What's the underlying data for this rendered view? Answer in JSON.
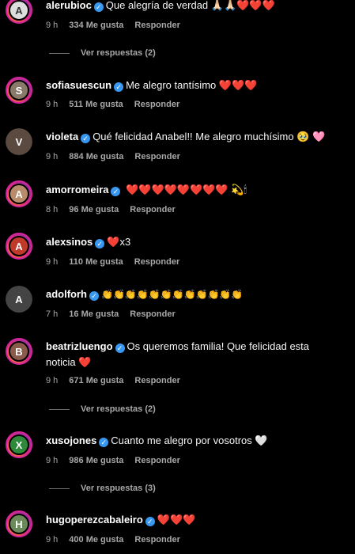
{
  "comments": [
    {
      "user": "alerubioc",
      "text": "Que alegría de verdad",
      "emoji": "🙏🏻🙏🏻❤️❤️❤️",
      "time": "9 h",
      "likes": "334 Me gusta",
      "reply": "Responder",
      "replies": "Ver respuestas (2)"
    },
    {
      "user": "sofiasuescun",
      "text": "Me alegro tantísimo",
      "emoji": "❤️❤️❤️",
      "time": "9 h",
      "likes": "511 Me gusta",
      "reply": "Responder"
    },
    {
      "user": "violeta",
      "text": "Qué felicidad Anabel!! Me alegro muchísimo",
      "emoji": "🥹 🩷",
      "time": "9 h",
      "likes": "884 Me gusta",
      "reply": "Responder"
    },
    {
      "user": "amorromeira",
      "text": "",
      "emoji": "❤️❤️❤️❤️❤️❤️❤️❤️ 💫🕯",
      "time": "8 h",
      "likes": "96 Me gusta",
      "reply": "Responder"
    },
    {
      "user": "alexsinos",
      "text": "x3",
      "emoji": "❤️",
      "time": "9 h",
      "likes": "110 Me gusta",
      "reply": "Responder"
    },
    {
      "user": "adolforh",
      "text": "",
      "emoji": "👏👏👏👏👏👏👏👏👏👏👏👏",
      "time": "7 h",
      "likes": "16 Me gusta",
      "reply": "Responder"
    },
    {
      "user": "beatrizluengo",
      "text": "Os queremos familia! Que felicidad esta noticia",
      "emoji": "❤️",
      "time": "9 h",
      "likes": "671 Me gusta",
      "reply": "Responder",
      "replies": "Ver respuestas (2)"
    },
    {
      "user": "xusojones",
      "text": "Cuanto me alegro por vosotros",
      "emoji": "🤍",
      "time": "9 h",
      "likes": "986 Me gusta",
      "reply": "Responder",
      "replies": "Ver respuestas (3)"
    },
    {
      "user": "hugoperezcabaleiro",
      "text": "",
      "emoji": "❤️❤️❤️",
      "time": "9 h",
      "likes": "400 Me gusta",
      "reply": "Responder"
    }
  ],
  "icons": {
    "verified": "verified-check-icon"
  }
}
